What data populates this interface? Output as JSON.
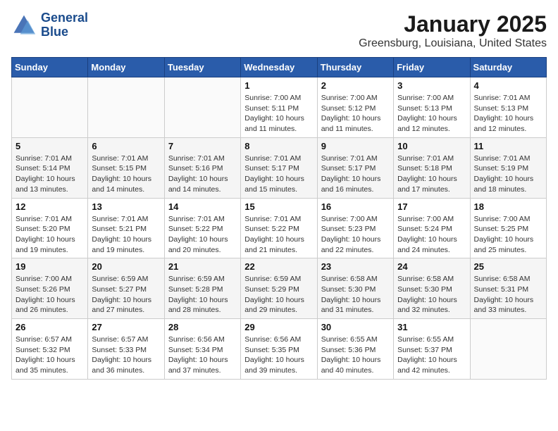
{
  "header": {
    "logo_line1": "General",
    "logo_line2": "Blue",
    "title": "January 2025",
    "subtitle": "Greensburg, Louisiana, United States"
  },
  "days_of_week": [
    "Sunday",
    "Monday",
    "Tuesday",
    "Wednesday",
    "Thursday",
    "Friday",
    "Saturday"
  ],
  "weeks": [
    [
      {
        "num": "",
        "detail": ""
      },
      {
        "num": "",
        "detail": ""
      },
      {
        "num": "",
        "detail": ""
      },
      {
        "num": "1",
        "detail": "Sunrise: 7:00 AM\nSunset: 5:11 PM\nDaylight: 10 hours\nand 11 minutes."
      },
      {
        "num": "2",
        "detail": "Sunrise: 7:00 AM\nSunset: 5:12 PM\nDaylight: 10 hours\nand 11 minutes."
      },
      {
        "num": "3",
        "detail": "Sunrise: 7:00 AM\nSunset: 5:13 PM\nDaylight: 10 hours\nand 12 minutes."
      },
      {
        "num": "4",
        "detail": "Sunrise: 7:01 AM\nSunset: 5:13 PM\nDaylight: 10 hours\nand 12 minutes."
      }
    ],
    [
      {
        "num": "5",
        "detail": "Sunrise: 7:01 AM\nSunset: 5:14 PM\nDaylight: 10 hours\nand 13 minutes."
      },
      {
        "num": "6",
        "detail": "Sunrise: 7:01 AM\nSunset: 5:15 PM\nDaylight: 10 hours\nand 14 minutes."
      },
      {
        "num": "7",
        "detail": "Sunrise: 7:01 AM\nSunset: 5:16 PM\nDaylight: 10 hours\nand 14 minutes."
      },
      {
        "num": "8",
        "detail": "Sunrise: 7:01 AM\nSunset: 5:17 PM\nDaylight: 10 hours\nand 15 minutes."
      },
      {
        "num": "9",
        "detail": "Sunrise: 7:01 AM\nSunset: 5:17 PM\nDaylight: 10 hours\nand 16 minutes."
      },
      {
        "num": "10",
        "detail": "Sunrise: 7:01 AM\nSunset: 5:18 PM\nDaylight: 10 hours\nand 17 minutes."
      },
      {
        "num": "11",
        "detail": "Sunrise: 7:01 AM\nSunset: 5:19 PM\nDaylight: 10 hours\nand 18 minutes."
      }
    ],
    [
      {
        "num": "12",
        "detail": "Sunrise: 7:01 AM\nSunset: 5:20 PM\nDaylight: 10 hours\nand 19 minutes."
      },
      {
        "num": "13",
        "detail": "Sunrise: 7:01 AM\nSunset: 5:21 PM\nDaylight: 10 hours\nand 19 minutes."
      },
      {
        "num": "14",
        "detail": "Sunrise: 7:01 AM\nSunset: 5:22 PM\nDaylight: 10 hours\nand 20 minutes."
      },
      {
        "num": "15",
        "detail": "Sunrise: 7:01 AM\nSunset: 5:22 PM\nDaylight: 10 hours\nand 21 minutes."
      },
      {
        "num": "16",
        "detail": "Sunrise: 7:00 AM\nSunset: 5:23 PM\nDaylight: 10 hours\nand 22 minutes."
      },
      {
        "num": "17",
        "detail": "Sunrise: 7:00 AM\nSunset: 5:24 PM\nDaylight: 10 hours\nand 24 minutes."
      },
      {
        "num": "18",
        "detail": "Sunrise: 7:00 AM\nSunset: 5:25 PM\nDaylight: 10 hours\nand 25 minutes."
      }
    ],
    [
      {
        "num": "19",
        "detail": "Sunrise: 7:00 AM\nSunset: 5:26 PM\nDaylight: 10 hours\nand 26 minutes."
      },
      {
        "num": "20",
        "detail": "Sunrise: 6:59 AM\nSunset: 5:27 PM\nDaylight: 10 hours\nand 27 minutes."
      },
      {
        "num": "21",
        "detail": "Sunrise: 6:59 AM\nSunset: 5:28 PM\nDaylight: 10 hours\nand 28 minutes."
      },
      {
        "num": "22",
        "detail": "Sunrise: 6:59 AM\nSunset: 5:29 PM\nDaylight: 10 hours\nand 29 minutes."
      },
      {
        "num": "23",
        "detail": "Sunrise: 6:58 AM\nSunset: 5:30 PM\nDaylight: 10 hours\nand 31 minutes."
      },
      {
        "num": "24",
        "detail": "Sunrise: 6:58 AM\nSunset: 5:30 PM\nDaylight: 10 hours\nand 32 minutes."
      },
      {
        "num": "25",
        "detail": "Sunrise: 6:58 AM\nSunset: 5:31 PM\nDaylight: 10 hours\nand 33 minutes."
      }
    ],
    [
      {
        "num": "26",
        "detail": "Sunrise: 6:57 AM\nSunset: 5:32 PM\nDaylight: 10 hours\nand 35 minutes."
      },
      {
        "num": "27",
        "detail": "Sunrise: 6:57 AM\nSunset: 5:33 PM\nDaylight: 10 hours\nand 36 minutes."
      },
      {
        "num": "28",
        "detail": "Sunrise: 6:56 AM\nSunset: 5:34 PM\nDaylight: 10 hours\nand 37 minutes."
      },
      {
        "num": "29",
        "detail": "Sunrise: 6:56 AM\nSunset: 5:35 PM\nDaylight: 10 hours\nand 39 minutes."
      },
      {
        "num": "30",
        "detail": "Sunrise: 6:55 AM\nSunset: 5:36 PM\nDaylight: 10 hours\nand 40 minutes."
      },
      {
        "num": "31",
        "detail": "Sunrise: 6:55 AM\nSunset: 5:37 PM\nDaylight: 10 hours\nand 42 minutes."
      },
      {
        "num": "",
        "detail": ""
      }
    ]
  ]
}
